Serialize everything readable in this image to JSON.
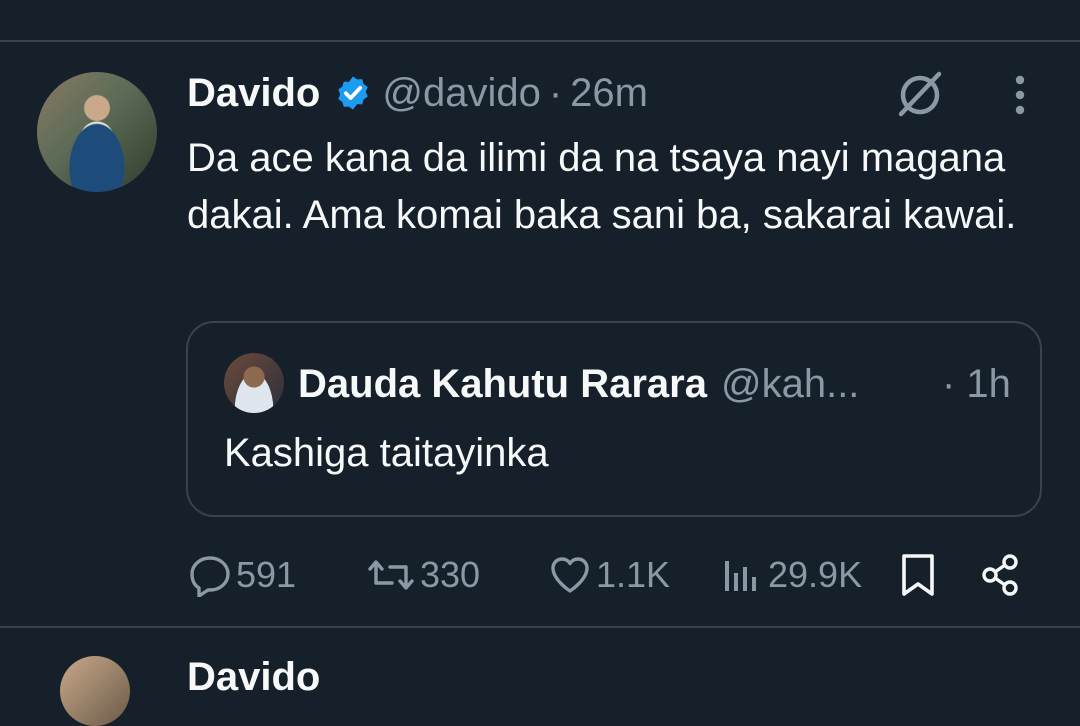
{
  "colors": {
    "background": "#15202b",
    "text": "#f7f9f9",
    "muted": "#8b98a5",
    "border": "#38444d",
    "verified": "#1d9bf0"
  },
  "tweet": {
    "display_name": "Davido",
    "handle": "@davido",
    "separator": "·",
    "time": "26m",
    "text": "Da ace kana da ilimi da na tsaya nayi magana dakai. Ama komai baka sani ba, sakarai kawai.",
    "quoted": {
      "display_name": "Dauda Kahutu Rarara",
      "handle": "@kah...",
      "time": "· 1h",
      "text": "Kashiga taitayinka"
    },
    "actions": {
      "replies": "591",
      "retweets": "330",
      "likes": "1.1K",
      "views": "29.9K"
    },
    "icons": [
      "verified-badge-icon",
      "grok-icon",
      "more-icon",
      "reply-icon",
      "retweet-icon",
      "like-icon",
      "views-icon",
      "bookmark-icon",
      "share-icon"
    ]
  },
  "next_tweet": {
    "display_name": "Davido"
  }
}
